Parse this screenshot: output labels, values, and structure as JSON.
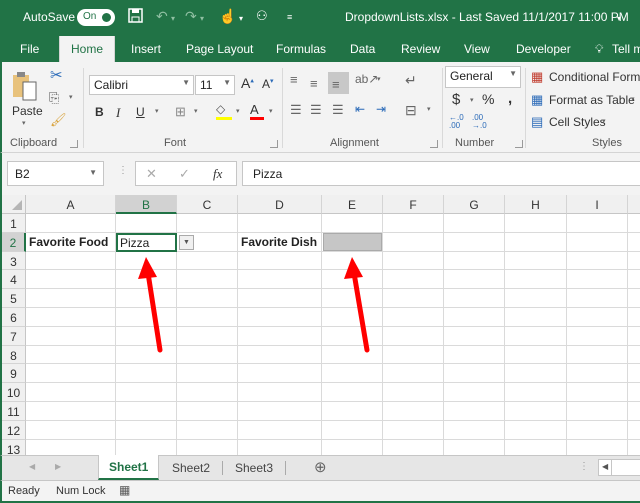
{
  "titlebar": {
    "autosave_label": "AutoSave",
    "autosave_state": "On",
    "document_title": "DropdownLists.xlsx  -  Last Saved 11/1/2017 11:00 PM",
    "title_dropdown_icon": "chevron-down-icon"
  },
  "quick_access": [
    {
      "icon": "save-icon"
    },
    {
      "icon": "undo-icon"
    },
    {
      "icon": "redo-icon"
    },
    {
      "icon": "touch-mode-icon"
    },
    {
      "icon": "org-chart-icon"
    },
    {
      "icon": "customize-toolbar-icon"
    }
  ],
  "ribbon_tabs": [
    "File",
    "Home",
    "Insert",
    "Page Layout",
    "Formulas",
    "Data",
    "Review",
    "View",
    "Developer",
    "Tell me"
  ],
  "active_tab": "Home",
  "ribbon": {
    "clipboard": {
      "label": "Clipboard",
      "paste": "Paste"
    },
    "font": {
      "label": "Font",
      "font_name": "Calibri",
      "font_size": "11",
      "bold": "B",
      "italic": "I",
      "underline": "U",
      "fill_color": "#ffff00",
      "font_color": "#ff0000"
    },
    "alignment": {
      "label": "Alignment"
    },
    "number": {
      "label": "Number",
      "format": "General",
      "currency": "$",
      "percent": "%",
      "comma": ","
    },
    "styles": {
      "label": "Styles",
      "conditional": "Conditional Formatting",
      "format_table": "Format as Table",
      "cell_styles": "Cell Styles"
    }
  },
  "formula_bar": {
    "name_box": "B2",
    "cancel": "✕",
    "enter": "✓",
    "fx": "fx",
    "value": "Pizza"
  },
  "grid": {
    "columns": [
      "A",
      "B",
      "C",
      "D",
      "E",
      "F",
      "G",
      "H",
      "I"
    ],
    "selected_column": "B",
    "rows": [
      "1",
      "2",
      "3",
      "4",
      "5",
      "6",
      "7",
      "8",
      "9",
      "10",
      "11",
      "12",
      "13"
    ],
    "selected_row": "2",
    "cells": {
      "A2": "Favorite Food",
      "B2": "Pizza",
      "D2": "Favorite Dish",
      "E2": ""
    },
    "arrow_color": "#ff0000"
  },
  "sheet_tabs": [
    "Sheet1",
    "Sheet2",
    "Sheet3"
  ],
  "active_sheet": "Sheet1",
  "status": {
    "ready": "Ready",
    "num_lock": "Num Lock"
  }
}
